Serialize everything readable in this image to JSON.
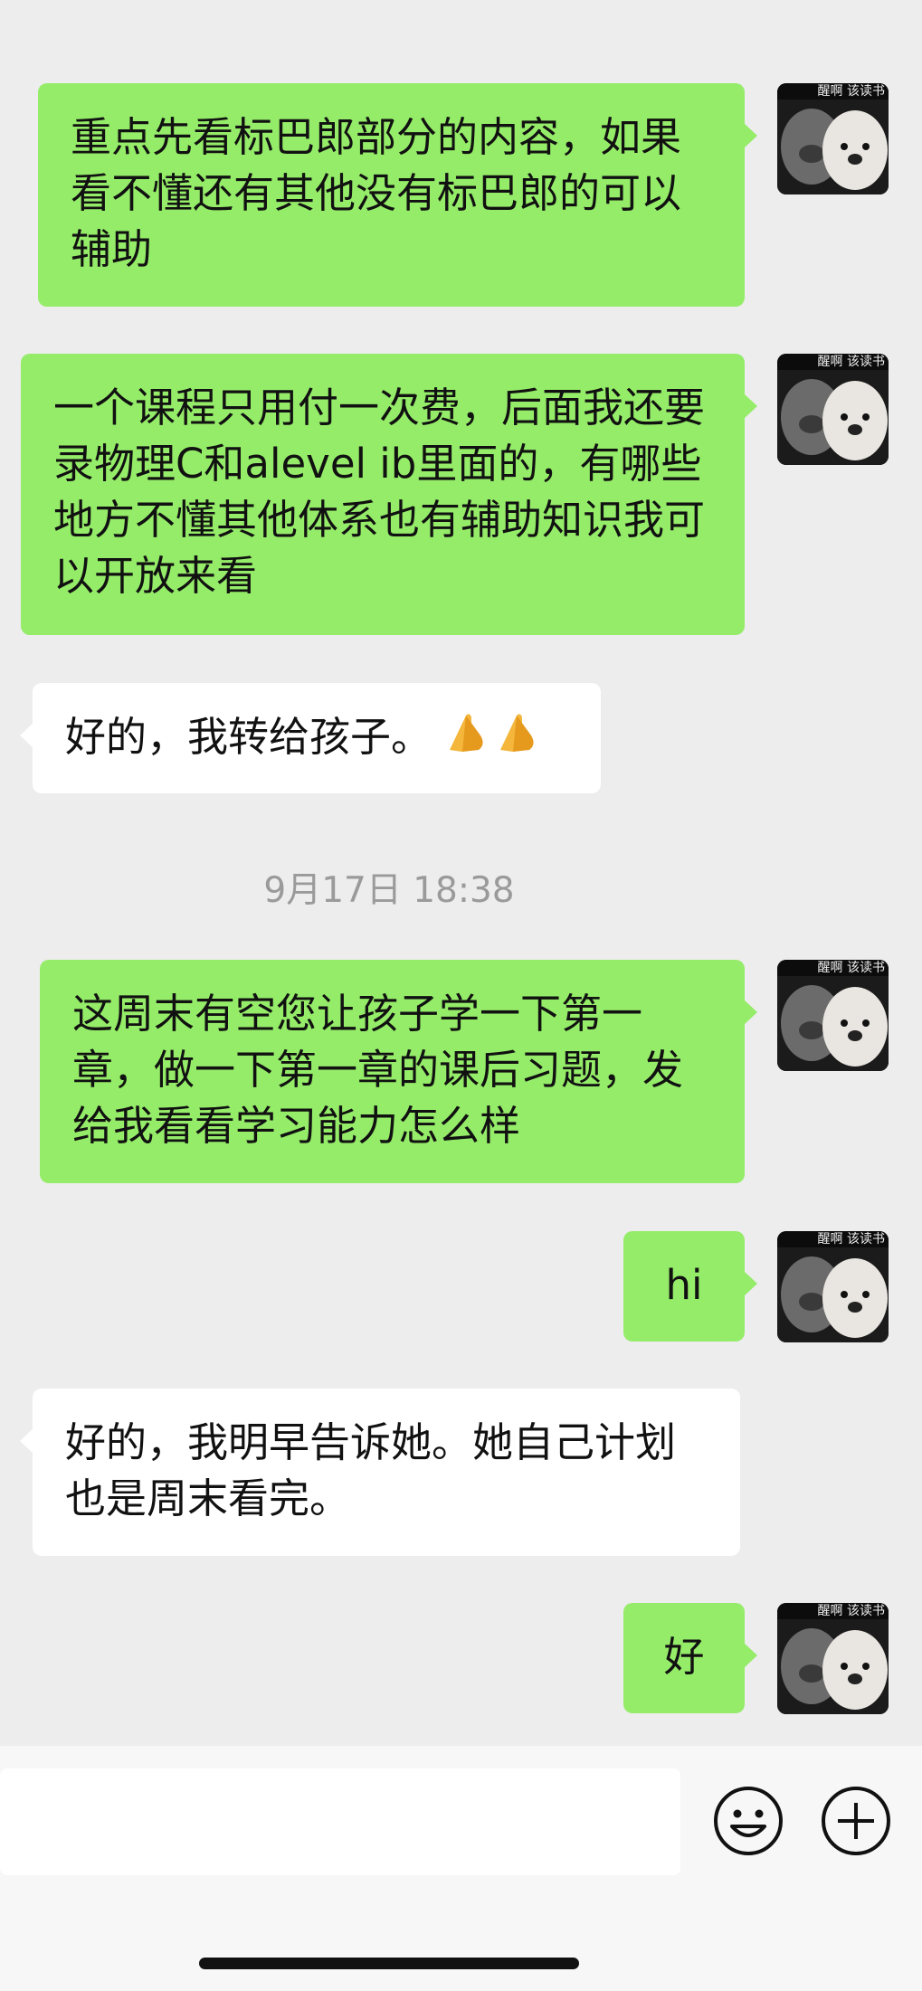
{
  "messages": [
    {
      "side": "out",
      "text": "重点先看标巴郎部分的内容，如果看不懂还有其他没有标巴郎的可以辅助"
    },
    {
      "side": "out",
      "text": "一个课程只用付一次费，后面我还要录物理C和alevel ib里面的，有哪些地方不懂其他体系也有辅助知识我可以开放来看"
    },
    {
      "side": "in",
      "text": "好的，我转给孩子。",
      "emoji": [
        "folded-hands-emoji",
        "folded-hands-emoji"
      ]
    },
    {
      "side": "out",
      "text": "这周末有空您让孩子学一下第一章，做一下第一章的课后习题，发给我看看学习能力怎么样"
    },
    {
      "side": "out",
      "text": "hi"
    },
    {
      "side": "in",
      "text": "好的，我明早告诉她。她自己计划也是周末看完。"
    },
    {
      "side": "out",
      "text": "好"
    }
  ],
  "timestamp": "9月17日 18:38",
  "avatar": {
    "caption": "醒啊 该读书"
  },
  "input": {
    "value": ""
  },
  "icons": {
    "emoji_button": "smiley-icon",
    "more_button": "plus-circle-icon"
  },
  "colors": {
    "out_bubble": "#95ec69",
    "in_bubble": "#ffffff",
    "background": "#ededed"
  }
}
